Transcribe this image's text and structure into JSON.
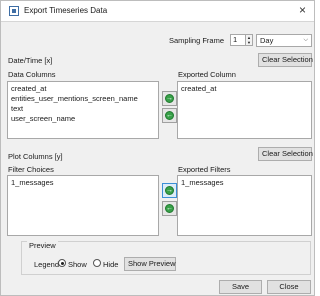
{
  "window": {
    "title": "Export Timeseries Data",
    "close_glyph": "×"
  },
  "sampling": {
    "label": "Sampling Frame",
    "value": "1",
    "unit": "Day",
    "spin_up": "▲",
    "spin_down": "▼",
    "caret": "⌵"
  },
  "datetime_label": "Date/Time [x]",
  "clear_selection_label": "Clear Selection",
  "data_columns": {
    "label": "Data Columns",
    "items": [
      "created_at",
      "entities_user_mentions_screen_name",
      "text",
      "user_screen_name"
    ]
  },
  "exported_column": {
    "label": "Exported Column",
    "items": [
      "created_at"
    ]
  },
  "plot_columns_label": "Plot Columns [y]",
  "filter_choices": {
    "label": "Filter Choices",
    "items": [
      "1_messages"
    ]
  },
  "exported_filters": {
    "label": "Exported Filters",
    "items": [
      "1_messages"
    ]
  },
  "arrows": {
    "right": "→",
    "left": "←"
  },
  "preview": {
    "group_label": "Preview",
    "legend_label": "Legend",
    "show_label": "Show",
    "hide_label": "Hide",
    "show_preview_label": "Show Preview",
    "legend_selected": "Show"
  },
  "footer": {
    "save_label": "Save",
    "close_label": "Close"
  }
}
